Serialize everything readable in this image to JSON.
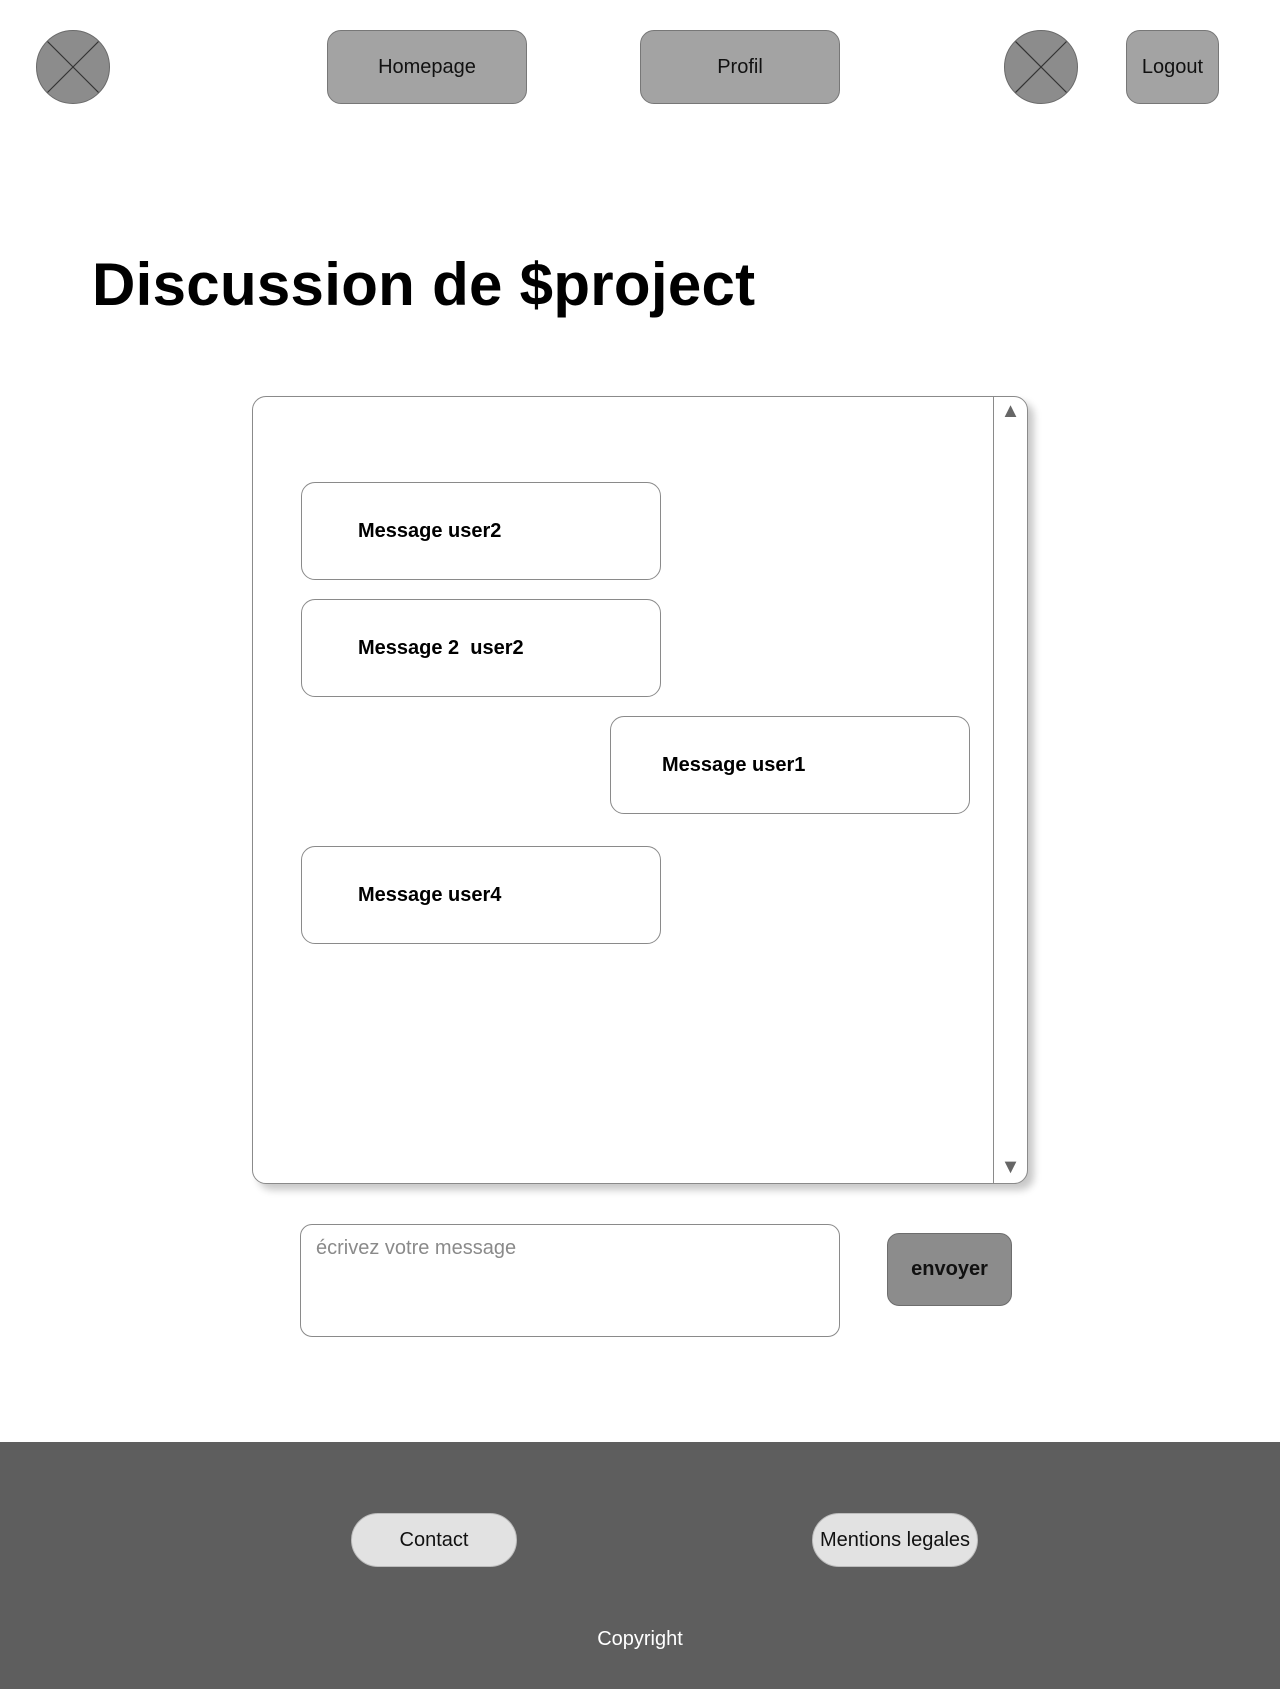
{
  "header": {
    "logo_icon": "image-placeholder-icon",
    "nav": {
      "homepage_label": "Homepage",
      "profil_label": "Profil"
    },
    "avatar_icon": "image-placeholder-icon",
    "logout_label": "Logout"
  },
  "main": {
    "title": "Discussion de $project",
    "chat": {
      "messages": [
        {
          "text": "Message user2",
          "align": "left"
        },
        {
          "text": "Message 2  user2",
          "align": "left"
        },
        {
          "text": "Message user1",
          "align": "right"
        },
        {
          "text": "Message user4",
          "align": "left"
        }
      ],
      "scroll_up_icon": "▲",
      "scroll_down_icon": "▼"
    },
    "composer": {
      "placeholder": "écrivez votre message",
      "value": "",
      "send_label": "envoyer"
    }
  },
  "footer": {
    "contact_label": "Contact",
    "legal_label": "Mentions legales",
    "copyright": "Copyright"
  },
  "colors": {
    "button_gray": "#a3a3a3",
    "send_gray": "#8c8c8c",
    "footer_bg": "#5e5e5e",
    "footer_pill": "#e2e2e2"
  }
}
